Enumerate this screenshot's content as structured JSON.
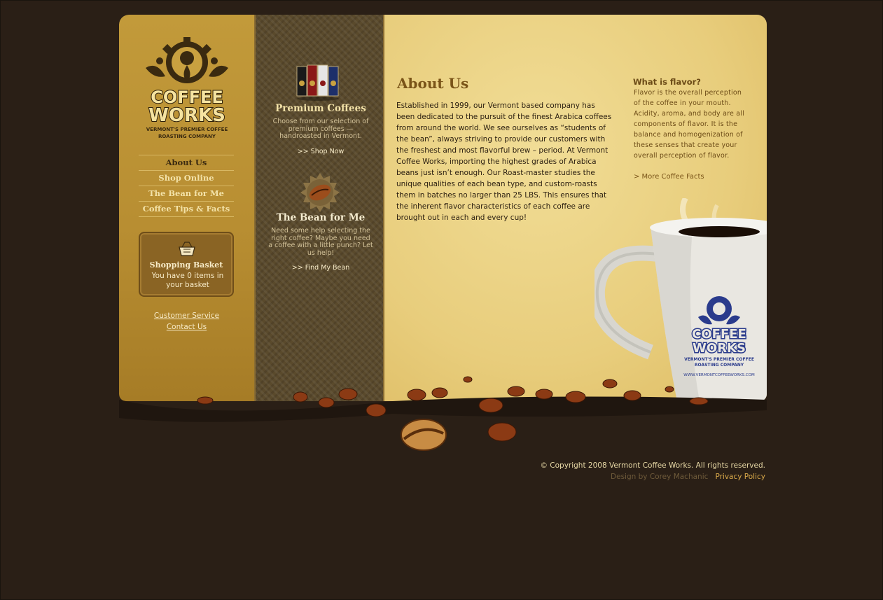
{
  "nav": {
    "items": [
      {
        "label": "About Us",
        "active": true
      },
      {
        "label": "Shop Online",
        "active": false
      },
      {
        "label": "The Bean for Me",
        "active": false
      },
      {
        "label": "Coffee Tips & Facts",
        "active": false
      }
    ]
  },
  "logo": {
    "line1": "COFFEE",
    "line2": "WORKS",
    "tagline1": "VERMONT'S PREMIER COFFEE",
    "tagline2": "ROASTING COMPANY"
  },
  "basket": {
    "icon": "basket-icon",
    "title": "Shopping Basket",
    "text": "You have 0 items in your basket"
  },
  "left_links": {
    "customer_service": "Customer Service",
    "contact_us": "Contact Us"
  },
  "promos": {
    "premium": {
      "title": "Premium Coffees",
      "desc": "Choose from our selection of premium coffees — handroasted in Vermont.",
      "link": ">> Shop Now"
    },
    "bean": {
      "title": "The Bean for Me",
      "desc": "Need some help selecting the right coffee? Maybe you need a coffee with a little punch? Let us help!",
      "link": ">> Find My Bean"
    }
  },
  "main": {
    "title": "About Us",
    "body": "Established in 1999, our Vermont based company has been dedicated to the pursuit of the finest Arabica coffees from around the world. We see ourselves as “students of the bean”, always striving to provide our customers with the freshest and most flavorful brew – period. At Vermont Coffee Works, importing the highest grades of Arabica beans just isn’t enough. Our Roast-master studies the unique qualities of each bean type, and custom-roasts them in batches no larger than 25 LBS. This ensures that the inherent flavor characteristics of each coffee are brought out in each and every cup!"
  },
  "sidebar": {
    "title": "What is flavor?",
    "text": "Flavor is the overall perception of the coffee in your mouth. Acidity, aroma, and body are all components of flavor. It is the balance and homogenization of these senses that create your overall perception of flavor.",
    "link": "> More Coffee Facts"
  },
  "mug": {
    "logo_line1": "COFFEE",
    "logo_line2": "WORKS",
    "tagline1": "VERMONT'S PREMIER COFFEE",
    "tagline2": "ROASTING COMPANY",
    "url": "WWW.VERMONTCOFFEEWORKS.COM"
  },
  "footer": {
    "copyright": "© Copyright 2008 Vermont Coffee Works. All rights reserved.",
    "design_credit": "Design by Corey Machanic",
    "privacy": "Privacy Policy"
  },
  "colors": {
    "page_bg": "#2a1f16",
    "left_panel": "#b88e32",
    "right_panel": "#e8cd7c",
    "title_brown": "#7a5418"
  }
}
